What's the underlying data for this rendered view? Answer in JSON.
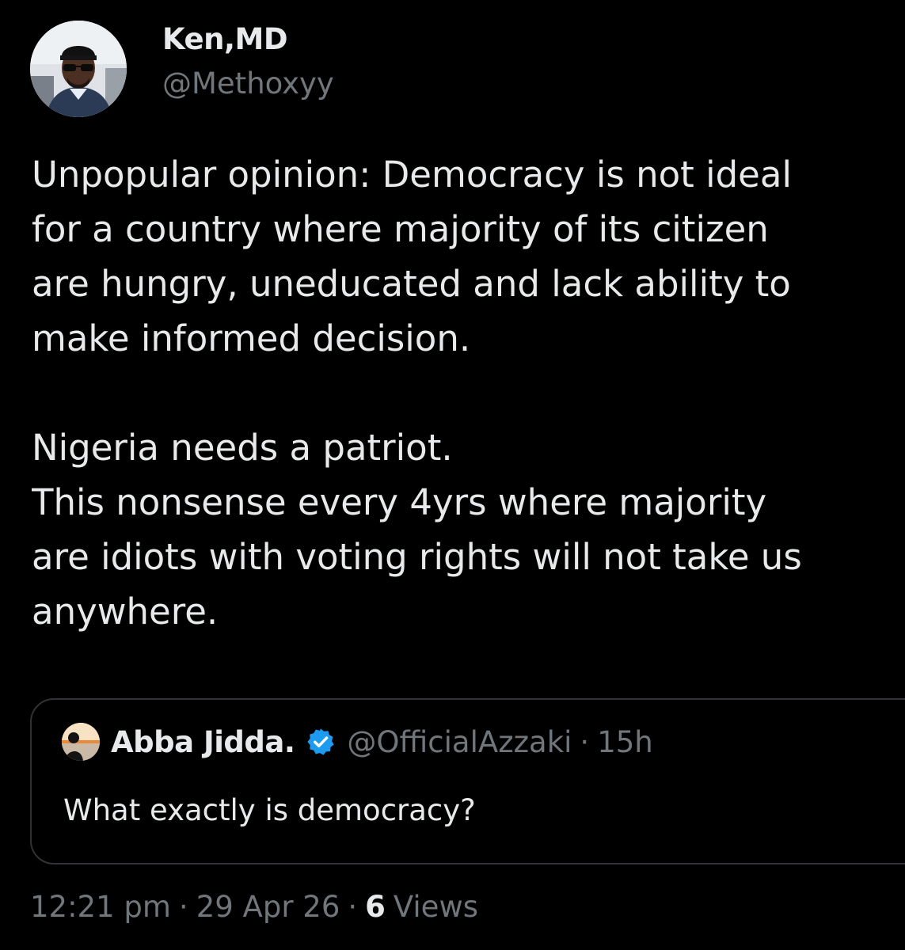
{
  "author": {
    "display_name": "Ken,MD",
    "handle": "@Methoxyy",
    "avatar_icon": "profile-photo"
  },
  "tweet": {
    "lines": [
      "Unpopular opinion: Democracy is not ideal",
      "for a country where majority of its citizen",
      "are hungry, uneducated and lack ability to",
      "make informed decision.",
      "Nigeria needs a patriot.",
      "This nonsense every 4yrs where majority",
      "are idiots with voting rights will not take us",
      "anywhere."
    ]
  },
  "quoted_tweet": {
    "display_name": "Abba Jidda.",
    "verified_icon": "verified-badge",
    "handle": "@OfficialAzzaki",
    "separator": "·",
    "time": "15h",
    "text": "What exactly is democracy?"
  },
  "meta": {
    "time": "12:21 pm",
    "separator": "·",
    "date": "29 Apr 26",
    "views_count": "6",
    "views_label": "Views"
  },
  "colors": {
    "background": "#000000",
    "text_primary": "#e7e9ea",
    "text_secondary": "#71767b",
    "border": "#2f3336",
    "verified": "#1d9bf0"
  }
}
